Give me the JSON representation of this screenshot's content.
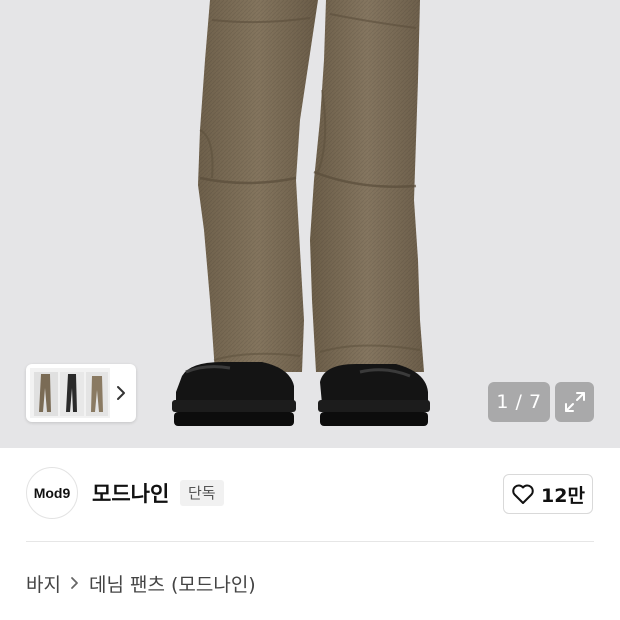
{
  "gallery": {
    "current": "1",
    "total": "7",
    "counter_text": "1 / 7",
    "icons": {
      "next": "chevron-right-icon",
      "expand": "expand-arrows-icon"
    }
  },
  "brand": {
    "logo_text": "Mod9",
    "name": "모드나인",
    "badge": "단독"
  },
  "like": {
    "icon": "heart-outline-icon",
    "count": "12만"
  },
  "breadcrumb": {
    "items": [
      "바지",
      "데님 팬츠 (모드나인)"
    ]
  },
  "colors": {
    "hero_bg": "#e5e5e7",
    "pants": "#7a6b55",
    "boots": "#111111",
    "overlay": "#787878"
  }
}
